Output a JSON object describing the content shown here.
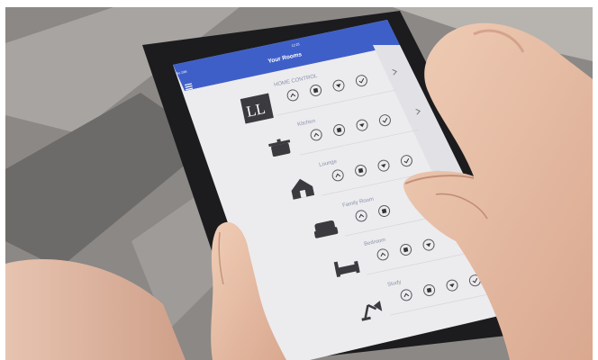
{
  "app": {
    "title": "Your Rooms",
    "status_left": "No SIM",
    "status_time": "12:25",
    "menu_icon": "hamburger-icon"
  },
  "rooms": [
    {
      "label": "HOME CONTROL",
      "icon": "ll-logo",
      "controls": [
        "up-arrow-icon",
        "stop-icon",
        "down-arrow-icon",
        "check-icon"
      ]
    },
    {
      "label": "Kitchen",
      "icon": "cooking-pot-icon",
      "controls": [
        "up-arrow-icon",
        "stop-icon",
        "down-arrow-icon",
        "check-icon"
      ]
    },
    {
      "label": "Lounge",
      "icon": "house-icon",
      "controls": [
        "up-arrow-icon",
        "stop-icon",
        "down-arrow-icon",
        "check-icon"
      ]
    },
    {
      "label": "Family Room",
      "icon": "armchair-icon",
      "controls": [
        "up-arrow-icon",
        "stop-icon"
      ]
    },
    {
      "label": "Bedroom",
      "icon": "bed-icon",
      "controls": [
        "up-arrow-icon",
        "stop-icon",
        "down-arrow-icon"
      ]
    },
    {
      "label": "Study",
      "icon": "desk-lamp-icon",
      "controls": [
        "up-arrow-icon",
        "stop-icon",
        "down-arrow-icon",
        "check-icon"
      ]
    }
  ],
  "logo_text": "LL",
  "colors": {
    "header": "#3f5fc8",
    "screen": "#ececef",
    "icon": "#3b3b3f",
    "tablet_bezel": "#1c1c1e"
  }
}
